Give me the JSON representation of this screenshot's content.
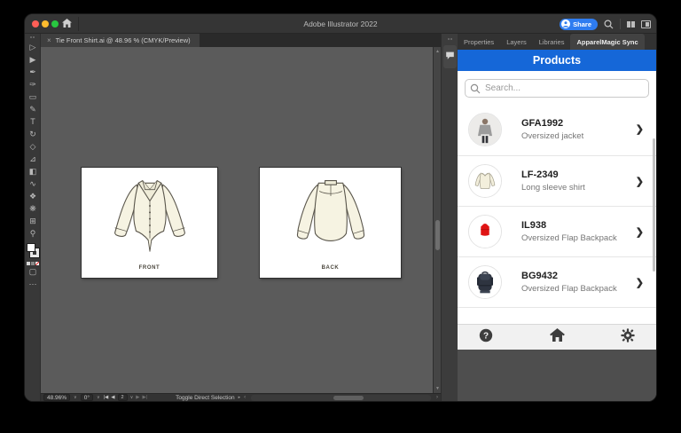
{
  "titlebar": {
    "app_title": "Adobe Illustrator 2022",
    "share_label": "Share"
  },
  "document_tab": {
    "close_label": "×",
    "title": "Tie Front Shirt.ai @ 48.96 % (CMYK/Preview)"
  },
  "toolbar": {
    "tools": [
      {
        "name": "selection-tool",
        "glyph": "▷"
      },
      {
        "name": "direct-selection-tool",
        "glyph": "▶"
      },
      {
        "name": "pen-tool",
        "glyph": "✒"
      },
      {
        "name": "curvature-tool",
        "glyph": "✑"
      },
      {
        "name": "rectangle-tool",
        "glyph": "▭"
      },
      {
        "name": "paintbrush-tool",
        "glyph": "✎"
      },
      {
        "name": "type-tool",
        "glyph": "T"
      },
      {
        "name": "rotate-tool",
        "glyph": "↻"
      },
      {
        "name": "eraser-tool",
        "glyph": "◇"
      },
      {
        "name": "scale-tool",
        "glyph": "⊿"
      },
      {
        "name": "gradient-tool",
        "glyph": "◧"
      },
      {
        "name": "pencil-tool",
        "glyph": "∿"
      },
      {
        "name": "blend-tool",
        "glyph": "❖"
      },
      {
        "name": "symbol-sprayer-tool",
        "glyph": "❋"
      },
      {
        "name": "artboard-tool",
        "glyph": "⊞"
      },
      {
        "name": "zoom-tool",
        "glyph": "⚲"
      }
    ],
    "screen_mode_glyph": "▢",
    "more_glyph": "⋯"
  },
  "artboards": [
    {
      "label": "FRONT"
    },
    {
      "label": "BACK"
    }
  ],
  "statusbar": {
    "zoom": "48.96%",
    "rotation": "0°",
    "artboard_number": "2",
    "tool_hint": "Toggle Direct Selection"
  },
  "panel": {
    "tabs": [
      {
        "label": "Properties"
      },
      {
        "label": "Layers"
      },
      {
        "label": "Libraries"
      },
      {
        "label": "ApparelMagic Sync"
      }
    ],
    "active_tab": "ApparelMagic Sync",
    "header_title": "Products",
    "search_placeholder": "Search...",
    "products": [
      {
        "code": "GFA1992",
        "description": "Oversized jacket"
      },
      {
        "code": "LF-2349",
        "description": "Long sleeve shirt"
      },
      {
        "code": "IL938",
        "description": "Oversized Flap Backpack"
      },
      {
        "code": "BG9432",
        "description": "Oversized Flap Backpack"
      }
    ],
    "footer_icons": [
      "help",
      "home",
      "settings"
    ]
  },
  "icons": {
    "chevron_right": "❯",
    "dropdown": "∨",
    "nav_first": "|◀",
    "nav_prev": "◀",
    "nav_next": "▶",
    "nav_last": "▶|",
    "hint_arrow": "▸",
    "hscroll_left": "‹",
    "hscroll_right": "›",
    "up_arrow": "▲",
    "down_arrow": "▼"
  },
  "colors": {
    "plugin_header_blue": "#1567d8",
    "share_blue": "#2e7cf0",
    "canvas_gray": "#5b5b5b",
    "chrome_dark": "#353535",
    "backpack_red": "#e01414",
    "backpack_navy": "#2e3440",
    "shirt_cream": "#f6f3e2"
  }
}
